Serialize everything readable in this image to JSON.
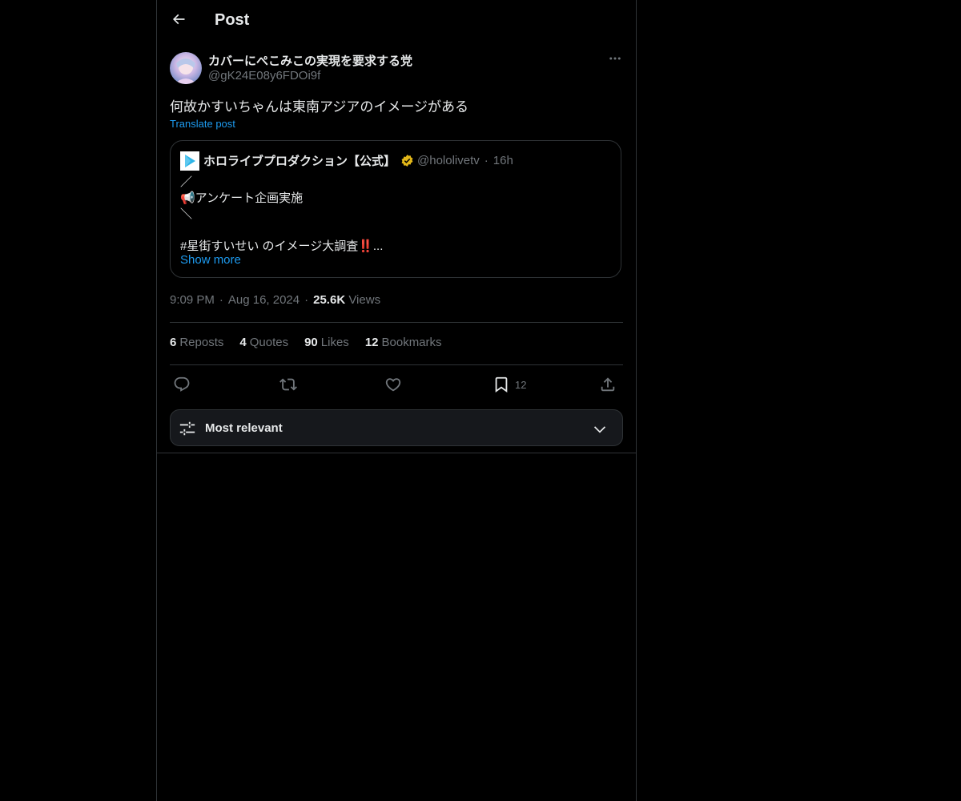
{
  "header": {
    "title": "Post",
    "back_icon": "arrow-left-icon"
  },
  "post": {
    "author": {
      "name": "カバーにぺこみこの実現を要求する党",
      "handle": "@gK24E08y6FDOi9f"
    },
    "text": "何故かすいちゃんは東南アジアのイメージがある",
    "translate_label": "Translate post",
    "quote": {
      "name": "ホロライブプロダクション【公式】",
      "handle": "@hololivetv",
      "time": "16h",
      "lines": [
        "／",
        "📢アンケート企画実施",
        "＼",
        "",
        "#星街すいせい のイメージ大調査‼️..."
      ],
      "show_more": "Show more",
      "verified_color": "#e2b719"
    },
    "meta": {
      "time": "9:09 PM",
      "date": "Aug 16, 2024",
      "views_count": "25.6K",
      "views_label": "Views"
    },
    "stats": {
      "reposts_count": "6",
      "reposts_label": "Reposts",
      "quotes_count": "4",
      "quotes_label": "Quotes",
      "likes_count": "90",
      "likes_label": "Likes",
      "bookmarks_count": "12",
      "bookmarks_label": "Bookmarks"
    },
    "actions": {
      "bookmark_count": "12"
    }
  },
  "sort": {
    "label": "Most relevant"
  },
  "colors": {
    "background": "#000000",
    "text": "#e7e9ea",
    "secondary": "#71767b",
    "link": "#1d9bf0",
    "border": "#2f3336"
  }
}
